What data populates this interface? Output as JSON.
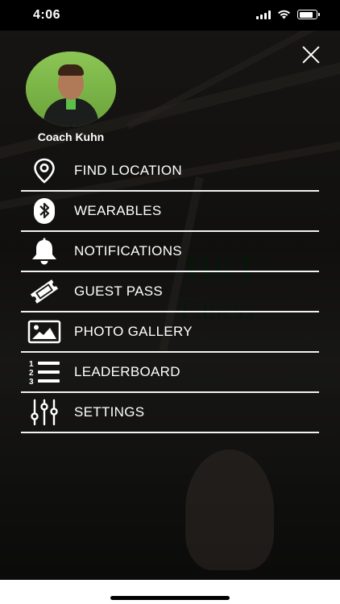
{
  "status_bar": {
    "time": "4:06",
    "battery_level": 0.8
  },
  "profile": {
    "name": "Coach Kuhn"
  },
  "background": {
    "logo_line1": "HiiT",
    "logo_line2": "Fitness"
  },
  "menu": {
    "items": [
      {
        "label": "FIND LOCATION",
        "icon": "location-pin-icon"
      },
      {
        "label": "WEARABLES",
        "icon": "bluetooth-icon"
      },
      {
        "label": "NOTIFICATIONS",
        "icon": "bell-icon"
      },
      {
        "label": "GUEST PASS",
        "icon": "ticket-icon"
      },
      {
        "label": "PHOTO GALLERY",
        "icon": "image-icon"
      },
      {
        "label": "LEADERBOARD",
        "icon": "numbered-list-icon"
      },
      {
        "label": "SETTINGS",
        "icon": "sliders-icon"
      }
    ]
  },
  "colors": {
    "text": "#ffffff",
    "divider": "#f2f2f2",
    "avatar_bg": "#7ab648"
  }
}
